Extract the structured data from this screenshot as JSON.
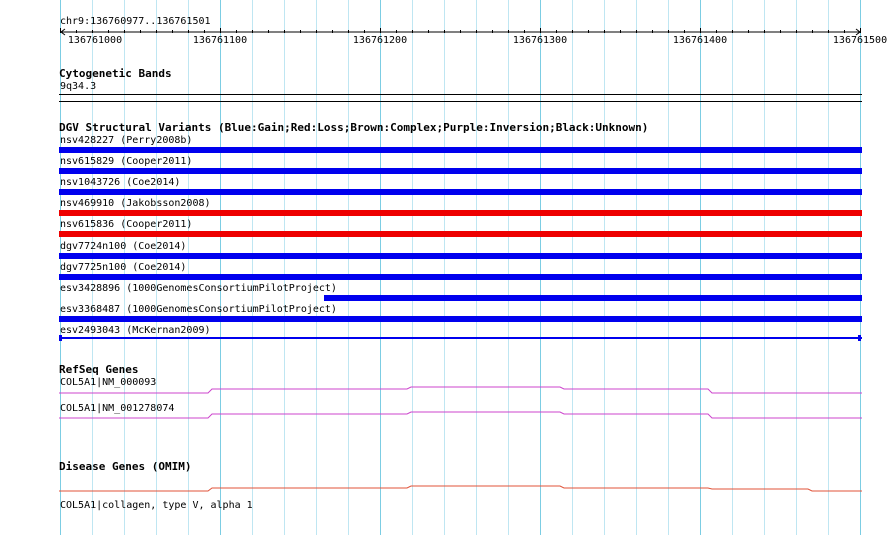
{
  "ruler": {
    "location": "chr9:136760977..136761501",
    "start": 136761000,
    "end": 136761500,
    "tick_labels": [
      "136761000",
      "136761100",
      "136761200",
      "136761300",
      "136761400",
      "136761500"
    ]
  },
  "cytoband": {
    "title": "Cytogenetic Bands",
    "band": "9q34.3"
  },
  "dgv": {
    "title": "DGV Structural Variants (Blue:Gain;Red:Loss;Brown:Complex;Purple:Inversion;Black:Unknown)",
    "variants": [
      {
        "label": "nsv428227 (Perry2008b)",
        "type": "gain",
        "color": "#0000ee",
        "start_frac": 0.0
      },
      {
        "label": "nsv615829 (Cooper2011)",
        "type": "gain",
        "color": "#0000ee",
        "start_frac": 0.0
      },
      {
        "label": "nsv1043726 (Coe2014)",
        "type": "gain",
        "color": "#0000ee",
        "start_frac": 0.0
      },
      {
        "label": "nsv469910 (Jakobsson2008)",
        "type": "loss",
        "color": "#ee0000",
        "start_frac": 0.0
      },
      {
        "label": "nsv615836 (Cooper2011)",
        "type": "loss",
        "color": "#ee0000",
        "start_frac": 0.0
      },
      {
        "label": "dgv7724n100 (Coe2014)",
        "type": "gain",
        "color": "#0000ee",
        "start_frac": 0.0
      },
      {
        "label": "dgv7725n100 (Coe2014)",
        "type": "gain",
        "color": "#0000ee",
        "start_frac": 0.0
      },
      {
        "label": "esv3428896 (1000GenomesConsortiumPilotProject)",
        "type": "gain",
        "color": "#0000ee",
        "start_frac": 0.33
      },
      {
        "label": "esv3368487 (1000GenomesConsortiumPilotProject)",
        "type": "gain",
        "color": "#0000ee",
        "start_frac": 0.0
      },
      {
        "label": "esv2493043 (McKernan2009)",
        "type": "gain",
        "color": "#0000ee",
        "start_frac": 0.0,
        "thin": true
      }
    ]
  },
  "refseq": {
    "title": "RefSeq Genes",
    "color": "#cc44cc",
    "genes": [
      {
        "label": "COL5A1|NM_000093"
      },
      {
        "label": "COL5A1|NM_001278074"
      }
    ]
  },
  "omim": {
    "title": "Disease Genes (OMIM)",
    "color": "#e0533a",
    "genes": [
      {
        "label": "COL5A1|collagen, type V, alpha 1"
      }
    ]
  }
}
